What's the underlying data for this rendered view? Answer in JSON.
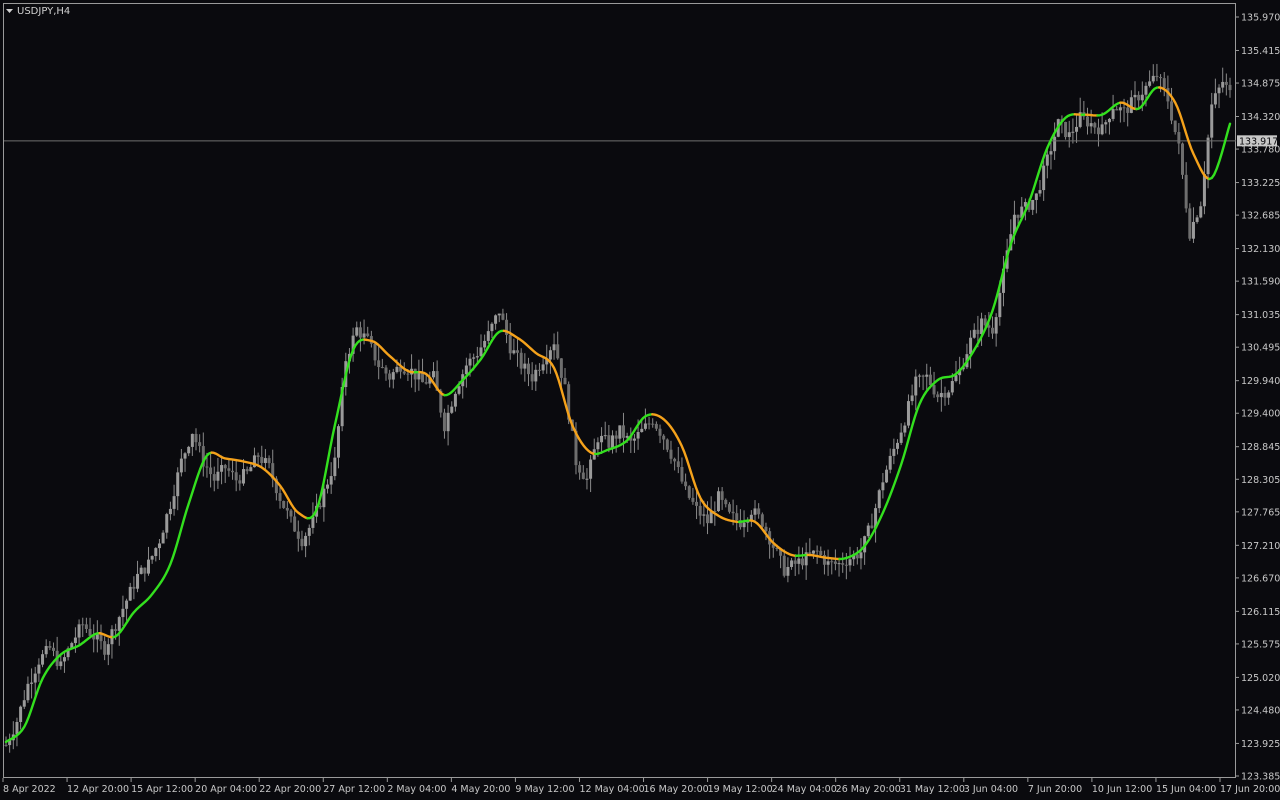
{
  "window": {
    "symbol_label": "USDJPY,H4"
  },
  "colors": {
    "background": "#0a0a0e",
    "candle": "#8a8a8a",
    "axis": "#9a9a9a",
    "text": "#c8c8c8",
    "ma_up": "#33e01e",
    "ma_down": "#f5a21b",
    "price_line": "#6f6f6f",
    "price_tag_bg": "#c8c8c8",
    "price_tag_text": "#0a0a0e"
  },
  "chart_data": {
    "type": "candlestick",
    "title": "USDJPY,H4",
    "grid": false,
    "ylim": [
      123.35,
      136.05
    ],
    "y_ticks": [
      "135.970",
      "135.415",
      "134.875",
      "134.320",
      "133.780",
      "133.225",
      "132.685",
      "132.130",
      "131.590",
      "131.035",
      "130.495",
      "129.940",
      "129.400",
      "128.845",
      "128.305",
      "127.765",
      "127.210",
      "126.670",
      "126.115",
      "125.575",
      "125.020",
      "124.480",
      "123.925",
      "123.385"
    ],
    "x_ticks": [
      "8 Apr 2022",
      "12 Apr 20:00",
      "15 Apr 12:00",
      "20 Apr 04:00",
      "22 Apr 20:00",
      "27 Apr 12:00",
      "2 May 04:00",
      "4 May 20:00",
      "9 May 12:00",
      "12 May 04:00",
      "16 May 20:00",
      "19 May 12:00",
      "24 May 04:00",
      "26 May 20:00",
      "31 May 12:00",
      "3 Jun 04:00",
      "7 Jun 20:00",
      "10 Jun 12:00",
      "15 Jun 04:00",
      "17 Jun 20:00"
    ],
    "current_price": "133.917",
    "price_path": [
      [
        0,
        123.9
      ],
      [
        3,
        124.3
      ],
      [
        6,
        124.9
      ],
      [
        9,
        125.3
      ],
      [
        12,
        125.5
      ],
      [
        15,
        125.2
      ],
      [
        18,
        125.6
      ],
      [
        21,
        125.9
      ],
      [
        24,
        125.7
      ],
      [
        27,
        125.5
      ],
      [
        30,
        125.9
      ],
      [
        33,
        126.3
      ],
      [
        36,
        126.7
      ],
      [
        39,
        126.9
      ],
      [
        42,
        127.3
      ],
      [
        45,
        127.9
      ],
      [
        48,
        128.6
      ],
      [
        51,
        129.1
      ],
      [
        54,
        128.6
      ],
      [
        57,
        128.3
      ],
      [
        60,
        128.5
      ],
      [
        63,
        128.3
      ],
      [
        66,
        128.4
      ],
      [
        69,
        128.7
      ],
      [
        72,
        128.5
      ],
      [
        75,
        128.0
      ],
      [
        78,
        127.6
      ],
      [
        81,
        127.3
      ],
      [
        84,
        127.6
      ],
      [
        87,
        128.1
      ],
      [
        90,
        128.6
      ],
      [
        93,
        130.3
      ],
      [
        96,
        130.8
      ],
      [
        99,
        130.6
      ],
      [
        102,
        130.2
      ],
      [
        105,
        130.0
      ],
      [
        108,
        130.2
      ],
      [
        111,
        130.1
      ],
      [
        114,
        129.9
      ],
      [
        117,
        130.0
      ],
      [
        120,
        129.2
      ],
      [
        123,
        129.8
      ],
      [
        126,
        130.2
      ],
      [
        129,
        130.4
      ],
      [
        132,
        130.7
      ],
      [
        135,
        131.1
      ],
      [
        138,
        130.5
      ],
      [
        141,
        130.2
      ],
      [
        144,
        130.0
      ],
      [
        147,
        130.3
      ],
      [
        150,
        130.6
      ],
      [
        153,
        129.8
      ],
      [
        156,
        128.6
      ],
      [
        159,
        128.3
      ],
      [
        162,
        129.0
      ],
      [
        165,
        128.9
      ],
      [
        168,
        129.1
      ],
      [
        171,
        128.9
      ],
      [
        174,
        129.1
      ],
      [
        177,
        129.3
      ],
      [
        180,
        129.0
      ],
      [
        183,
        128.6
      ],
      [
        186,
        128.1
      ],
      [
        189,
        127.8
      ],
      [
        192,
        127.6
      ],
      [
        195,
        128.0
      ],
      [
        198,
        127.7
      ],
      [
        201,
        127.6
      ],
      [
        204,
        127.8
      ],
      [
        207,
        127.6
      ],
      [
        210,
        127.2
      ],
      [
        213,
        126.8
      ],
      [
        216,
        126.9
      ],
      [
        219,
        127.0
      ],
      [
        222,
        127.1
      ],
      [
        225,
        126.9
      ],
      [
        228,
        126.9
      ],
      [
        231,
        127.0
      ],
      [
        234,
        127.1
      ],
      [
        237,
        127.6
      ],
      [
        240,
        128.3
      ],
      [
        243,
        128.8
      ],
      [
        246,
        129.3
      ],
      [
        249,
        129.9
      ],
      [
        252,
        130.0
      ],
      [
        255,
        129.7
      ],
      [
        258,
        129.8
      ],
      [
        261,
        130.1
      ],
      [
        264,
        130.6
      ],
      [
        267,
        130.9
      ],
      [
        270,
        130.8
      ],
      [
        273,
        131.7
      ],
      [
        276,
        132.7
      ],
      [
        279,
        132.8
      ],
      [
        282,
        133.0
      ],
      [
        285,
        133.6
      ],
      [
        288,
        134.2
      ],
      [
        291,
        134.0
      ],
      [
        294,
        134.3
      ],
      [
        297,
        134.2
      ],
      [
        300,
        134.1
      ],
      [
        303,
        134.5
      ],
      [
        306,
        134.4
      ],
      [
        309,
        134.6
      ],
      [
        312,
        134.8
      ],
      [
        315,
        135.0
      ],
      [
        318,
        134.6
      ],
      [
        321,
        133.8
      ],
      [
        324,
        132.4
      ],
      [
        327,
        132.9
      ],
      [
        330,
        134.5
      ],
      [
        333,
        134.9
      ],
      [
        335,
        134.7
      ]
    ],
    "ma_series": {
      "name": "",
      "x_range": [
        0,
        335
      ],
      "points": [
        [
          0,
          123.95
        ],
        [
          5,
          124.2
        ],
        [
          10,
          125.0
        ],
        [
          15,
          125.4
        ],
        [
          20,
          125.55
        ],
        [
          25,
          125.75
        ],
        [
          30,
          125.7
        ],
        [
          35,
          126.1
        ],
        [
          40,
          126.4
        ],
        [
          45,
          126.9
        ],
        [
          50,
          127.9
        ],
        [
          55,
          128.7
        ],
        [
          60,
          128.65
        ],
        [
          65,
          128.6
        ],
        [
          70,
          128.5
        ],
        [
          75,
          128.2
        ],
        [
          80,
          127.75
        ],
        [
          85,
          127.8
        ],
        [
          90,
          129.2
        ],
        [
          95,
          130.45
        ],
        [
          100,
          130.6
        ],
        [
          105,
          130.35
        ],
        [
          110,
          130.1
        ],
        [
          115,
          130.05
        ],
        [
          120,
          129.7
        ],
        [
          125,
          129.95
        ],
        [
          130,
          130.3
        ],
        [
          135,
          130.75
        ],
        [
          140,
          130.65
        ],
        [
          145,
          130.4
        ],
        [
          150,
          130.15
        ],
        [
          155,
          129.2
        ],
        [
          160,
          128.75
        ],
        [
          165,
          128.8
        ],
        [
          170,
          128.95
        ],
        [
          175,
          129.35
        ],
        [
          180,
          129.3
        ],
        [
          185,
          128.85
        ],
        [
          190,
          128.0
        ],
        [
          195,
          127.7
        ],
        [
          200,
          127.6
        ],
        [
          205,
          127.6
        ],
        [
          210,
          127.25
        ],
        [
          215,
          127.05
        ],
        [
          220,
          127.05
        ],
        [
          225,
          127.0
        ],
        [
          230,
          127.0
        ],
        [
          235,
          127.2
        ],
        [
          240,
          127.75
        ],
        [
          245,
          128.55
        ],
        [
          250,
          129.55
        ],
        [
          255,
          129.95
        ],
        [
          260,
          130.05
        ],
        [
          265,
          130.45
        ],
        [
          270,
          131.1
        ],
        [
          275,
          132.2
        ],
        [
          280,
          132.9
        ],
        [
          285,
          133.8
        ],
        [
          290,
          134.3
        ],
        [
          295,
          134.35
        ],
        [
          300,
          134.35
        ],
        [
          305,
          134.55
        ],
        [
          310,
          134.45
        ],
        [
          315,
          134.8
        ],
        [
          320,
          134.55
        ],
        [
          325,
          133.7
        ],
        [
          330,
          133.3
        ],
        [
          335,
          134.2
        ]
      ]
    }
  }
}
